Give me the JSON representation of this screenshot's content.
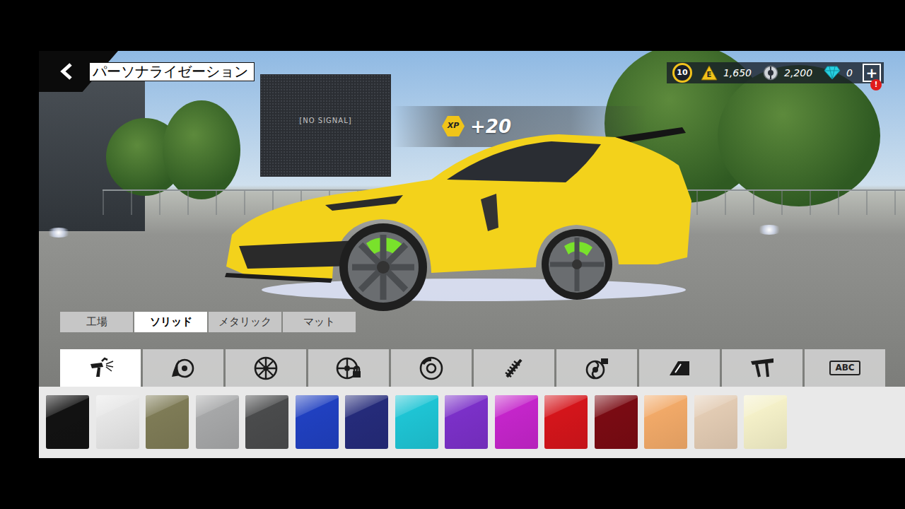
{
  "header": {
    "title": "パーソナライゼーション"
  },
  "wallet": {
    "level": "10",
    "energy_symbol": "E",
    "energy": "1,650",
    "parts": "2,200",
    "gems": "0",
    "add_button": "+",
    "alert_badge": "!"
  },
  "scene": {
    "screen_text": "[NO SIGNAL]",
    "xp_symbol": "XP",
    "xp_gain": "+20"
  },
  "finish_tabs": [
    {
      "label": "工場",
      "selected": false
    },
    {
      "label": "ソリッド",
      "selected": true
    },
    {
      "label": "メタリック",
      "selected": false
    },
    {
      "label": "マット",
      "selected": false
    }
  ],
  "categories": [
    {
      "kind": "icon",
      "selected": true
    },
    {
      "kind": "icon",
      "selected": false
    },
    {
      "kind": "icon",
      "selected": false
    },
    {
      "kind": "icon",
      "selected": false
    },
    {
      "kind": "icon",
      "selected": false
    },
    {
      "kind": "icon",
      "selected": false
    },
    {
      "kind": "icon",
      "selected": false
    },
    {
      "kind": "icon",
      "selected": false
    },
    {
      "kind": "icon",
      "selected": false
    },
    {
      "kind": "plate",
      "label": "ABC",
      "selected": false
    }
  ],
  "swatches": [
    {
      "color": "#121212",
      "selected": false
    },
    {
      "color": "#e6e6e6",
      "selected": false
    },
    {
      "color": "#7e7b56",
      "selected": false
    },
    {
      "color": "#a6a7a8",
      "selected": false
    },
    {
      "color": "#4a4b4c",
      "selected": false
    },
    {
      "color": "#2040c0",
      "selected": false
    },
    {
      "color": "#252b7a",
      "selected": false
    },
    {
      "color": "#1ec4d4",
      "selected": false
    },
    {
      "color": "#7b30c8",
      "selected": false
    },
    {
      "color": "#c425ca",
      "selected": false
    },
    {
      "color": "#d4151b",
      "selected": false
    },
    {
      "color": "#7a0b13",
      "selected": false
    },
    {
      "color": "#f1a968",
      "selected": false
    },
    {
      "color": "#e2cbb3",
      "selected": false
    },
    {
      "color": "#f4f0c8",
      "selected": false
    }
  ]
}
